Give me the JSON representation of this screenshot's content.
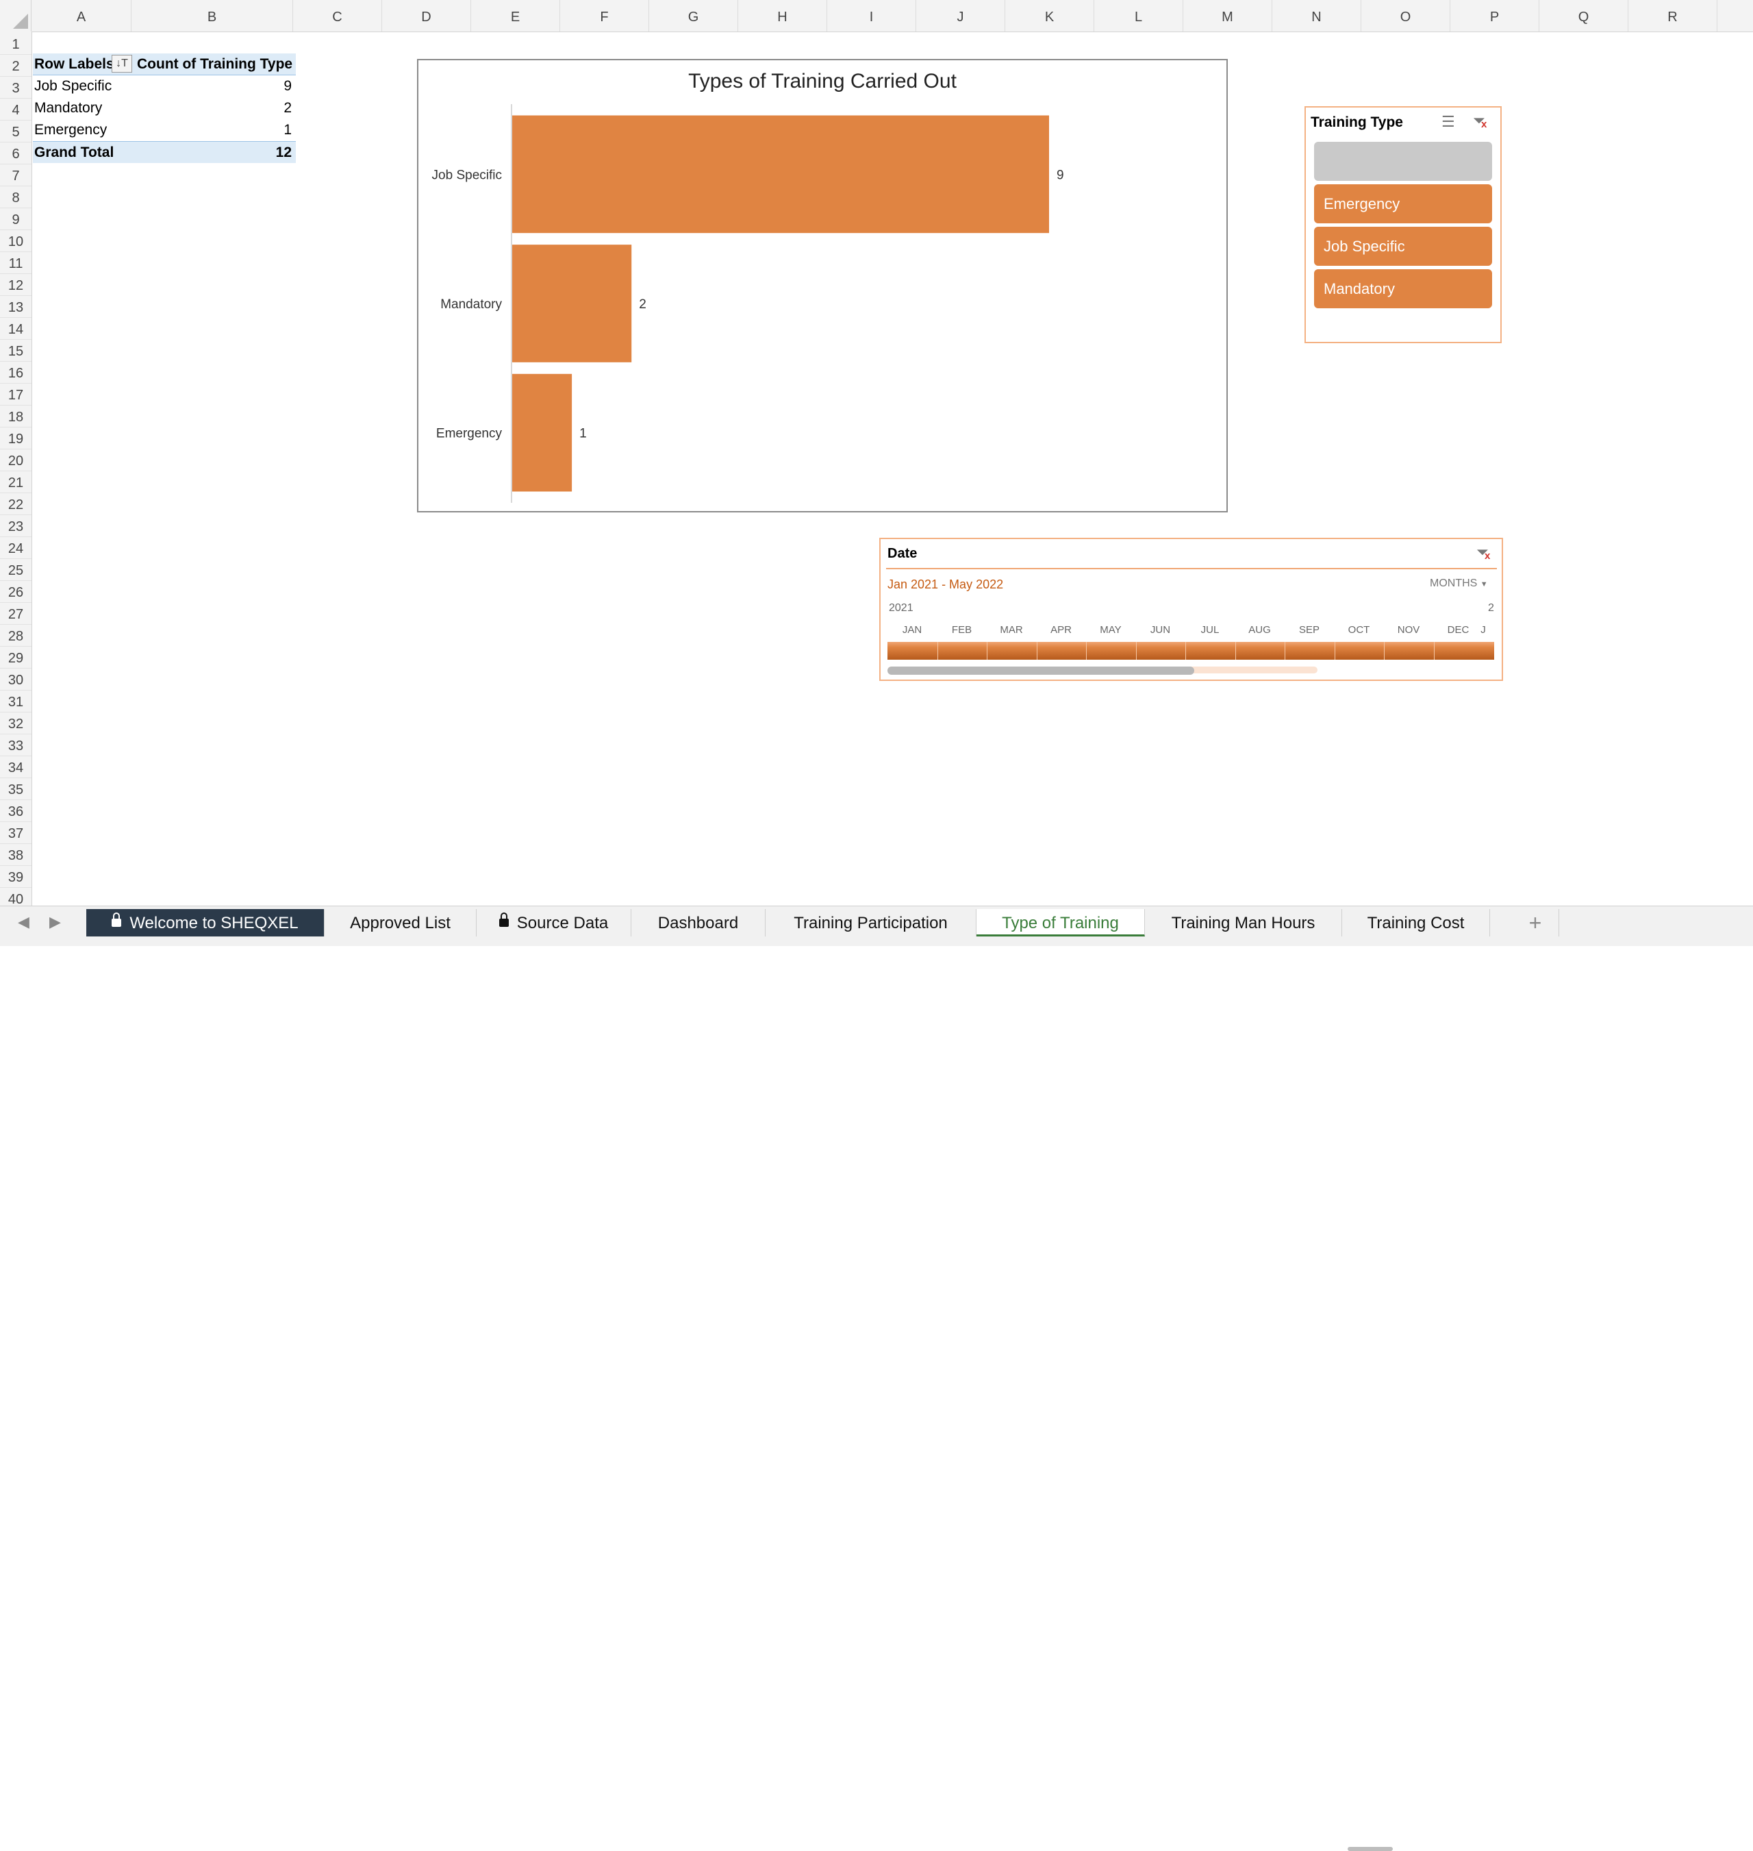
{
  "columns": [
    "A",
    "B",
    "C",
    "D",
    "E",
    "F",
    "G",
    "H",
    "I",
    "J",
    "K",
    "L",
    "M",
    "N",
    "O",
    "P",
    "Q",
    "R"
  ],
  "rows": [
    "1",
    "2",
    "3",
    "4",
    "5",
    "6",
    "7",
    "8",
    "9",
    "10",
    "11",
    "12",
    "13",
    "14",
    "15",
    "16",
    "17",
    "18",
    "19",
    "20",
    "21",
    "22",
    "23",
    "24",
    "25",
    "26",
    "27",
    "28",
    "29",
    "30",
    "31",
    "32",
    "33",
    "34",
    "35",
    "36",
    "37",
    "38",
    "39",
    "40"
  ],
  "pivot": {
    "header_label": "Row Labels",
    "header_value": "Count of Training Type",
    "rows": [
      {
        "label": "Job Specific",
        "value": "9"
      },
      {
        "label": "Mandatory",
        "value": "2"
      },
      {
        "label": "Emergency",
        "value": "1"
      }
    ],
    "total_label": "Grand Total",
    "total_value": "12"
  },
  "chart_data": {
    "type": "bar",
    "orientation": "horizontal",
    "title": "Types of Training Carried Out",
    "categories": [
      "Job Specific",
      "Mandatory",
      "Emergency"
    ],
    "values": [
      9,
      2,
      1
    ],
    "data_labels": true,
    "gridlines": false,
    "legend": "none",
    "bar_color": "#e08442"
  },
  "slicer": {
    "title": "Training Type",
    "items": [
      "",
      "Emergency",
      "Job Specific",
      "Mandatory"
    ],
    "selected_color": "#e08442",
    "blank_color": "#c9c9c9"
  },
  "timeline": {
    "title": "Date",
    "range": "Jan 2021 - May 2022",
    "level": "MONTHS",
    "year_left": "2021",
    "year_right": "2",
    "months": [
      "JAN",
      "FEB",
      "MAR",
      "APR",
      "MAY",
      "JUN",
      "JUL",
      "AUG",
      "SEP",
      "OCT",
      "NOV",
      "DEC",
      "J"
    ]
  },
  "tabs": [
    {
      "label": "Welcome to SHEQXEL",
      "locked": true,
      "style": "dark"
    },
    {
      "label": "Approved List",
      "locked": false,
      "style": "normal"
    },
    {
      "label": "Source Data",
      "locked": true,
      "style": "normal"
    },
    {
      "label": "Dashboard",
      "locked": false,
      "style": "normal"
    },
    {
      "label": "Training Participation",
      "locked": false,
      "style": "normal"
    },
    {
      "label": "Type of Training",
      "locked": false,
      "style": "active"
    },
    {
      "label": "Training Man Hours",
      "locked": false,
      "style": "normal"
    },
    {
      "label": "Training Cost",
      "locked": false,
      "style": "normal"
    }
  ],
  "add_tab": "+"
}
